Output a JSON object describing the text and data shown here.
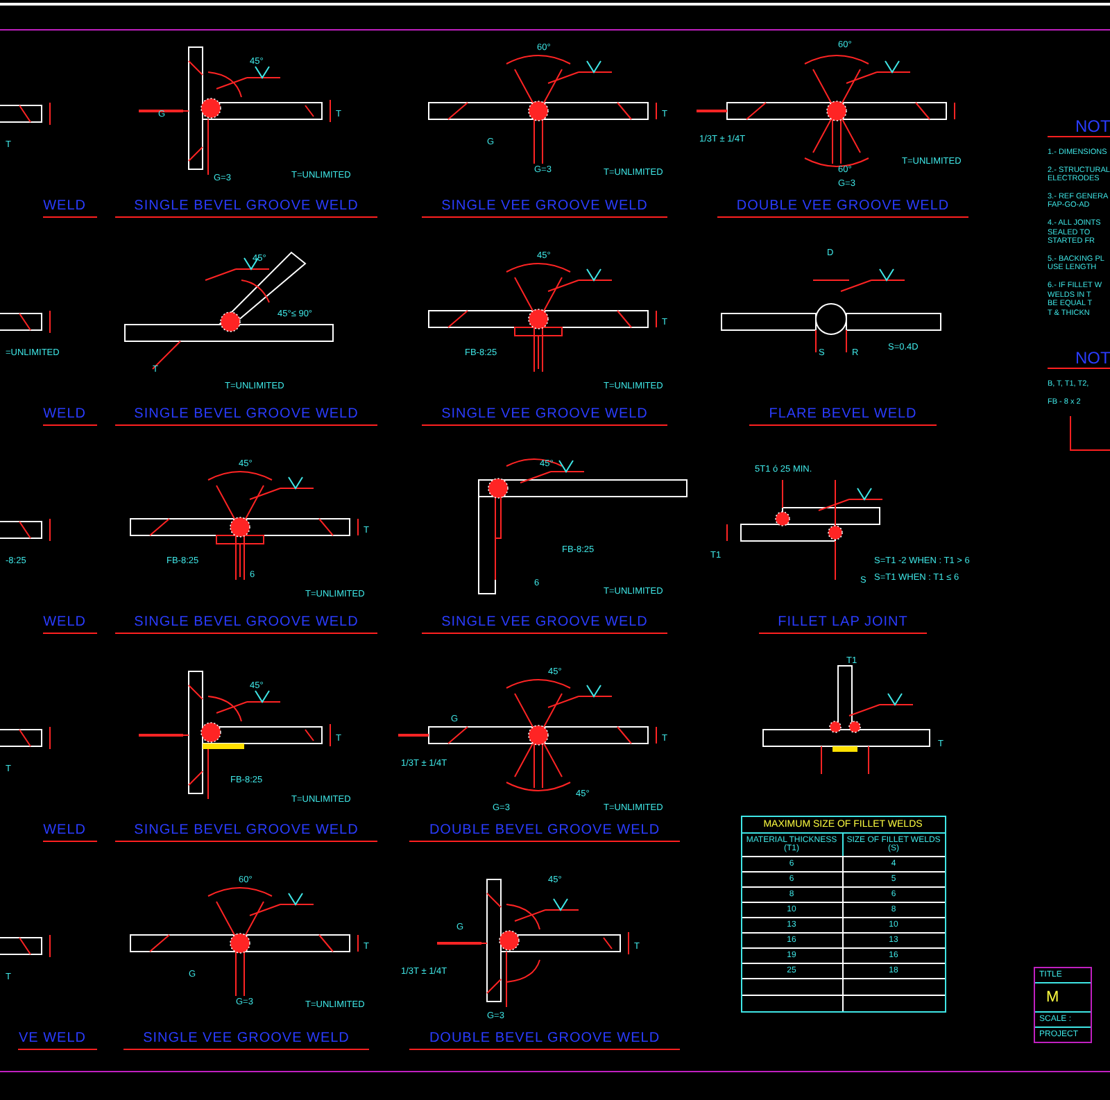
{
  "details": [
    {
      "kind": "clipped-plate",
      "title": "WELD",
      "annotations": [
        "T"
      ]
    },
    {
      "kind": "tee",
      "title": "SINGLE BEVEL GROOVE WELD",
      "annotations": [
        "45°",
        "G",
        "T",
        "G=3",
        "T=UNLIMITED"
      ]
    },
    {
      "kind": "butt",
      "title": "SINGLE VEE GROOVE WELD",
      "annotations": [
        "60°",
        "G",
        "G=3",
        "T",
        "T=UNLIMITED"
      ]
    },
    {
      "kind": "double-vee",
      "title": "DOUBLE VEE GROOVE WELD",
      "annotations": [
        "60°",
        "1/3T ± 1/4T",
        "60°",
        "G=3",
        "T=UNLIMITED"
      ]
    },
    {
      "kind": "clipped-plate",
      "title": "WELD",
      "annotations": [
        "=UNLIMITED"
      ]
    },
    {
      "kind": "angled",
      "title": "SINGLE BEVEL GROOVE WELD",
      "annotations": [
        "45°",
        "45°≤ 90°",
        "T",
        "T=UNLIMITED"
      ]
    },
    {
      "kind": "butt-backing",
      "title": "SINGLE VEE GROOVE WELD",
      "annotations": [
        "45°",
        "FB-8:25",
        "T",
        "T=UNLIMITED"
      ]
    },
    {
      "kind": "flare",
      "title": "FLARE BEVEL WELD",
      "annotations": [
        "D",
        "S",
        "R",
        "S=0.4D"
      ]
    },
    {
      "kind": "clipped-plate",
      "title": "WELD",
      "annotations": [
        "-8:25"
      ]
    },
    {
      "kind": "butt-backing",
      "title": "SINGLE BEVEL GROOVE WELD",
      "annotations": [
        "45°",
        "FB-8:25",
        "T",
        "T=UNLIMITED",
        "6"
      ]
    },
    {
      "kind": "corner",
      "title": "SINGLE VEE GROOVE WELD",
      "annotations": [
        "45°",
        "FB-8:25",
        "6",
        "T=UNLIMITED"
      ]
    },
    {
      "kind": "lap",
      "title": "FILLET LAP JOINT",
      "annotations": [
        "5T1 ó 25 MIN.",
        "T1",
        "S",
        "S=T1 -2  WHEN : T1 > 6",
        "S=T1      WHEN : T1 ≤ 6"
      ]
    },
    {
      "kind": "clipped-plate",
      "title": "WELD",
      "annotations": [
        "T"
      ]
    },
    {
      "kind": "tee-backing",
      "title": "SINGLE BEVEL GROOVE WELD",
      "annotations": [
        "45°",
        "FB-8:25",
        "T",
        "T=UNLIMITED"
      ]
    },
    {
      "kind": "double-bevel",
      "title": "DOUBLE BEVEL GROOVE WELD",
      "annotations": [
        "45°",
        "1/3T ± 1/4T",
        "G",
        "45°",
        "G=3",
        "T",
        "T=UNLIMITED"
      ]
    },
    {
      "kind": "tee-fillet",
      "annotations": [
        "T1",
        "T"
      ]
    },
    {
      "kind": "clipped-plate",
      "title": "VE WELD",
      "annotations": [
        "T"
      ]
    },
    {
      "kind": "butt",
      "title": "SINGLE VEE GROOVE WELD",
      "annotations": [
        "60°",
        "G",
        "G=3",
        "T",
        "T=UNLIMITED"
      ]
    },
    {
      "kind": "double-bevel-tee",
      "title": "DOUBLE BEVEL GROOVE WELD",
      "annotations": [
        "45°",
        "1/3T ± 1/4T",
        "G",
        "G=3",
        "T"
      ]
    },
    {
      "kind": "table"
    }
  ],
  "fillet_table": {
    "title": "MAXIMUM SIZE OF FILLET WELDS",
    "columns": [
      "MATERIAL THICKNESS (T1)",
      "SIZE OF FILLET WELDS (S)"
    ],
    "rows": [
      [
        "6",
        "4"
      ],
      [
        "6",
        "5"
      ],
      [
        "8",
        "6"
      ],
      [
        "10",
        "8"
      ],
      [
        "13",
        "10"
      ],
      [
        "16",
        "13"
      ],
      [
        "19",
        "16"
      ],
      [
        "25",
        "18"
      ]
    ]
  },
  "notes": {
    "heading": "NOT",
    "items": [
      "1.- DIMENSIONS",
      "2.- STRUCTURAL\nELECTRODES",
      "3.- REF GENERA\nFAP-GO-AD",
      "4.- ALL JOINTS\nSEALED TO\nSTARTED FR",
      "5.- BACKING PL\nUSE LENGTH",
      "6.- IF FILLET W\nWELDS IN T\nBE EQUAL T\nT & THICKN"
    ]
  },
  "nomenclature": {
    "heading": "NOT",
    "items": [
      "B, T, T1, T2,",
      "FB - 8 x 2"
    ]
  },
  "title_block": {
    "title_label": "TITLE",
    "title_value": "M",
    "scale_label": "SCALE :",
    "project_label": "PROJECT"
  }
}
